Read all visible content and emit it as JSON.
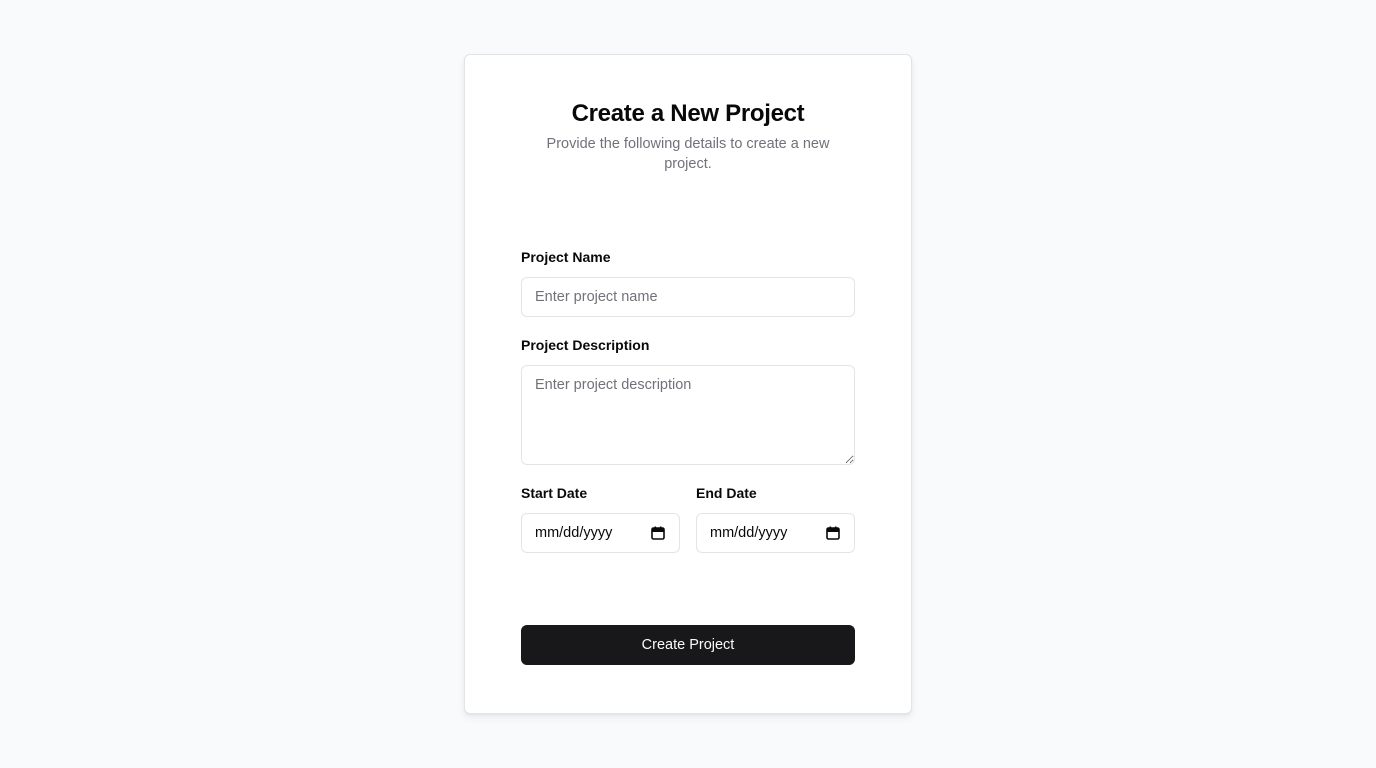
{
  "form": {
    "title": "Create a New Project",
    "subtitle": "Provide the following details to create a new project.",
    "project_name": {
      "label": "Project Name",
      "placeholder": "Enter project name",
      "value": ""
    },
    "project_description": {
      "label": "Project Description",
      "placeholder": "Enter project description",
      "value": ""
    },
    "start_date": {
      "label": "Start Date",
      "display": "mm/dd/yyyy",
      "icon": "calendar-icon"
    },
    "end_date": {
      "label": "End Date",
      "display": "mm/dd/yyyy",
      "icon": "calendar-icon"
    },
    "submit_label": "Create Project"
  },
  "colors": {
    "background": "#f8fafc",
    "card": "#ffffff",
    "border": "#e4e4e7",
    "muted_text": "#71717a",
    "primary_button": "#18181b",
    "primary_button_text": "#fafafa"
  }
}
